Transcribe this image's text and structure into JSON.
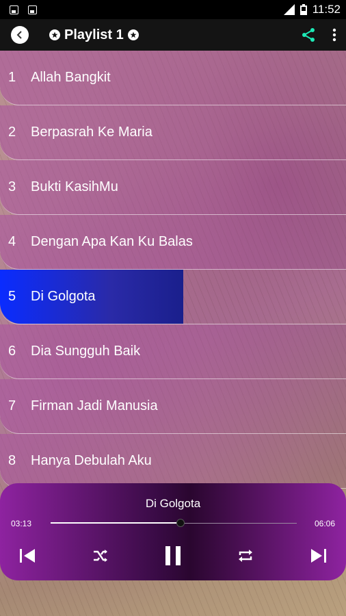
{
  "status_bar": {
    "time": "11:52"
  },
  "header": {
    "title": "Playlist 1"
  },
  "playlist": [
    {
      "num": "1",
      "title": "Allah Bangkit"
    },
    {
      "num": "2",
      "title": "Berpasrah Ke Maria"
    },
    {
      "num": "3",
      "title": "Bukti KasihMu"
    },
    {
      "num": "4",
      "title": "Dengan Apa Kan Ku Balas"
    },
    {
      "num": "5",
      "title": "Di Golgota",
      "active": true
    },
    {
      "num": "6",
      "title": "Dia Sungguh Baik"
    },
    {
      "num": "7",
      "title": "Firman Jadi Manusia"
    },
    {
      "num": "8",
      "title": "Hanya Debulah Aku"
    }
  ],
  "player": {
    "now_playing": "Di Golgota",
    "current_time": "03:13",
    "duration": "06:06",
    "progress": 0.527
  },
  "colors": {
    "accent_share": "#1de9b6",
    "highlight": "#0a2cff",
    "player_purple": "#8e23a0"
  },
  "icons": [
    "back-icon",
    "star-icon",
    "share-icon",
    "more-vert-icon",
    "previous-icon",
    "shuffle-icon",
    "pause-icon",
    "repeat-icon",
    "next-icon"
  ]
}
